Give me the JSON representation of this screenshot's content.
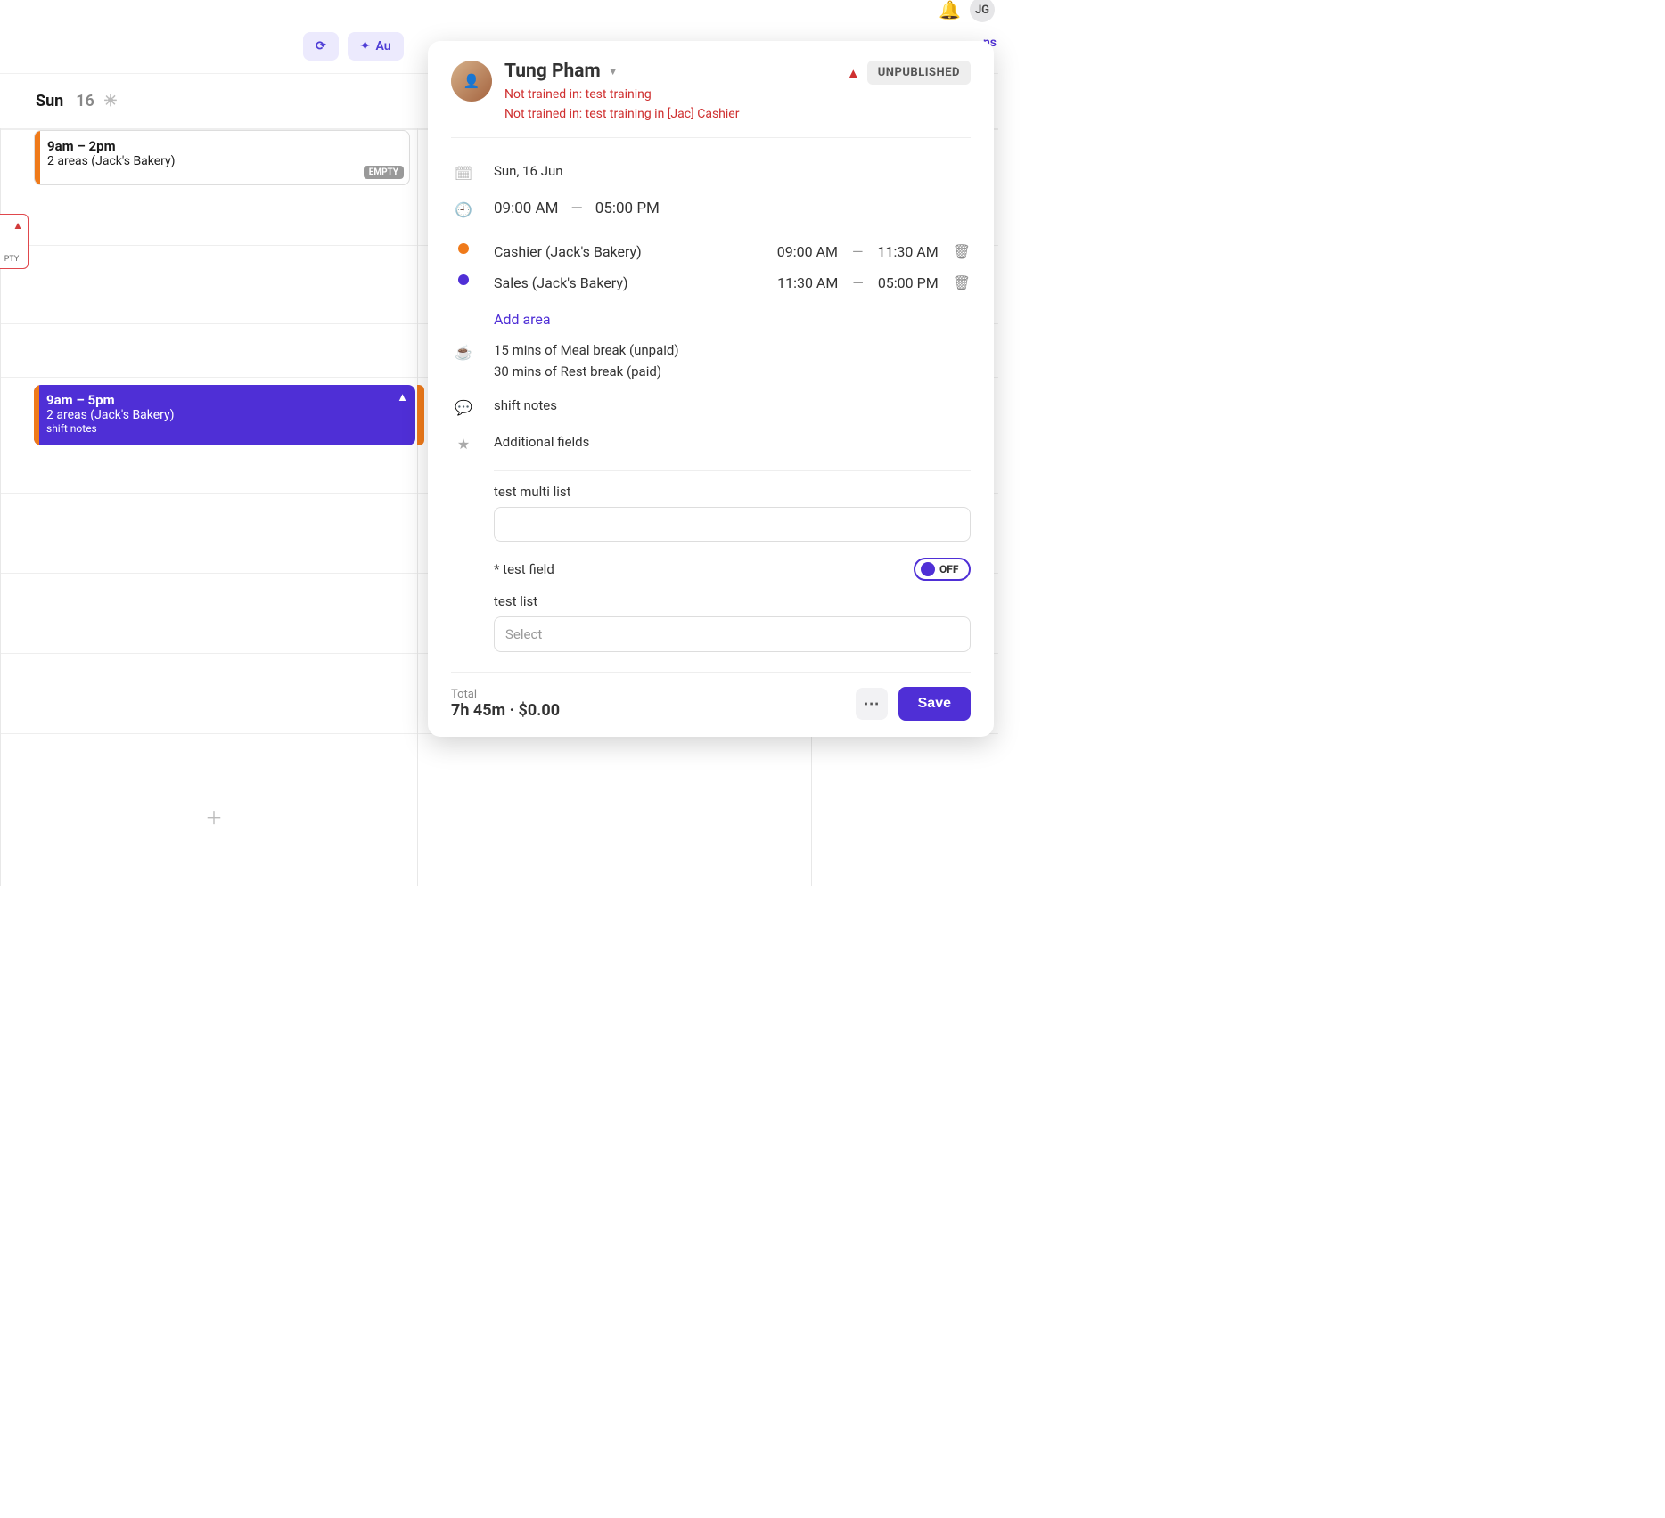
{
  "topbar": {
    "user_initials": "JG"
  },
  "toolbar": {
    "refresh_tooltip": "Refresh",
    "auto_label": "Au",
    "right_fragment": "ns"
  },
  "calendar": {
    "day_label": "Sun",
    "day_num": "16",
    "shift_empty_time": "9am – 2pm",
    "shift_empty_sub": "2 areas (Jack's Bakery)",
    "empty_badge": "EMPTY",
    "edge_badge": "PTY",
    "shift_active_time": "9am – 5pm",
    "shift_active_sub": "2 areas (Jack's Bakery)",
    "shift_active_notes": "shift notes"
  },
  "panel": {
    "person_name": "Tung Pham",
    "status": "UNPUBLISHED",
    "warnings": [
      "Not trained in: test training",
      "Not trained in: test training in [Jac] Cashier"
    ],
    "date": "Sun, 16 Jun",
    "start_time": "09:00 AM",
    "end_time": "05:00 PM",
    "areas": [
      {
        "color": "orange",
        "name": "Cashier (Jack's Bakery)",
        "from": "09:00 AM",
        "to": "11:30 AM"
      },
      {
        "color": "purple",
        "name": "Sales (Jack's Bakery)",
        "from": "11:30 AM",
        "to": "05:00 PM"
      }
    ],
    "add_area_label": "Add area",
    "breaks": [
      "15 mins of Meal break (unpaid)",
      "30 mins of Rest break (paid)"
    ],
    "notes_label": "shift notes",
    "additional_label": "Additional fields",
    "fields": {
      "multi_list_label": "test multi list",
      "toggle_label": "* test field",
      "toggle_state": "OFF",
      "select_label": "test list",
      "select_placeholder": "Select"
    },
    "total_label": "Total",
    "total_value": "7h 45m · $0.00",
    "save_label": "Save"
  }
}
